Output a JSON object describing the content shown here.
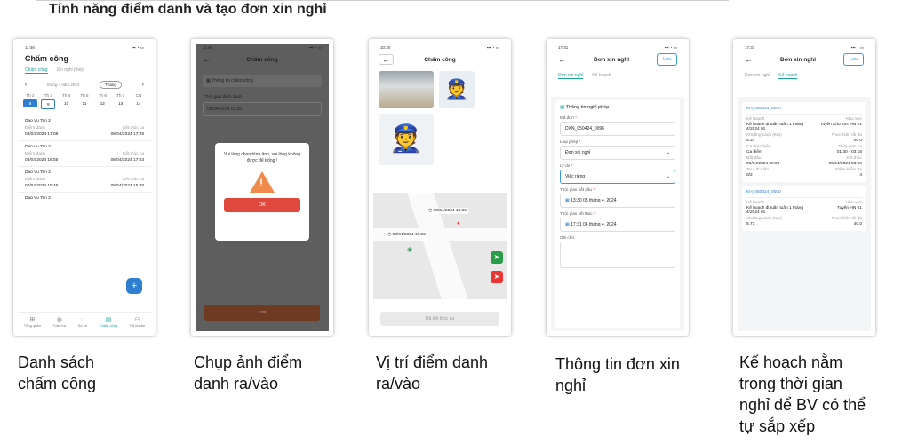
{
  "page_title": "Tính năng điểm danh và tạo đơn xin nghỉ",
  "captions": [
    [
      "Danh sách",
      "chấm công"
    ],
    [
      "Chụp ảnh điểm",
      "danh ra/vào"
    ],
    [
      "Vị trí điểm danh",
      "ra/vào"
    ],
    [
      "Thông tin đơn xin",
      "nghỉ"
    ],
    [
      "Kế hoạch nằm",
      "trong thời gian",
      "nghỉ để BV có thể",
      "tự sắp xếp"
    ]
  ],
  "s1": {
    "time": "11:46",
    "title": "Chấm công",
    "tab1": "Chấm công",
    "tab2": "Xin nghỉ phép",
    "week": "tháng 4 năm 2024",
    "mode": "Tháng",
    "days": [
      {
        "d": "Th 2",
        "n": "8"
      },
      {
        "d": "Th 3",
        "n": "9"
      },
      {
        "d": "Th 4",
        "n": "10"
      },
      {
        "d": "Th 5",
        "n": "11"
      },
      {
        "d": "Th 6",
        "n": "12"
      },
      {
        "d": "Th 7",
        "n": "13"
      },
      {
        "d": "CN",
        "n": "14"
      }
    ],
    "records": [
      {
        "name": "Dao Vu Tan 2",
        "l1": "Điểm danh",
        "l2": "Kết thúc ca",
        "v1": "08/04/2024 17:08",
        "v2": "08/04/2024 17:09"
      },
      {
        "name": "Dao Vu Tan 2",
        "l1": "Điểm danh",
        "l2": "Kết thúc ca",
        "v1": "08/04/2024 16:55",
        "v2": "08/04/2024 17:03"
      },
      {
        "name": "Dao Vu Tan 2",
        "l1": "Điểm danh",
        "l2": "Kết thúc ca",
        "v1": "08/04/2024 15:46",
        "v2": "08/04/2024 15:48"
      },
      {
        "name": "Dao Vu Tan 2",
        "l1": "",
        "l2": "",
        "v1": "",
        "v2": ""
      }
    ],
    "nav": [
      "Tổng quan",
      "Tuần tra",
      "Sự cố",
      "Chấm công",
      "Tài khoản"
    ]
  },
  "s2": {
    "time": "11:46",
    "title": "Chấm công",
    "section": "Thông tin chấm công",
    "time_label": "Thời gian điểm danh",
    "time_value": "08/04/2024 15:38",
    "dialog_text": "Vui lòng chọn hình ảnh, vui lòng không được để trống !",
    "ok": "OK",
    "bottom": "Lưu"
  },
  "s3": {
    "time": "10:20",
    "title": "Chấm công",
    "marker1": "08/04/2024 19:36",
    "marker2": "08/04/2024 19:36",
    "end_btn": "Đã kết thúc ca"
  },
  "s4": {
    "time": "17:31",
    "title": "Đơn xin nghỉ",
    "save": "Lưu",
    "tab1": "Đơn xin nghỉ",
    "tab2": "Kế hoạch",
    "section": "Thông tin nghỉ phép",
    "code_label": "Mã đơn",
    "code_value": "DXN_050424_0096",
    "type_label": "Loại phép",
    "type_value": "Đơn xin nghỉ",
    "reason_label": "Lý do",
    "reason_value": "Việc riêng",
    "start_label": "Thời gian bắt đầu",
    "start_value": "13:30 05 tháng 4, 2024",
    "end_label": "Thời gian kết thúc",
    "end_value": "17:31 06 tháng 4, 2024",
    "note_label": "Ghi chú"
  },
  "s5": {
    "time": "17:31",
    "title": "Đơn xin nghỉ",
    "save": "Lưu",
    "tab1": "Đơn xin nghỉ",
    "tab2": "Kế hoạch",
    "plans": [
      {
        "code": "KH_050424_0000",
        "k1": "Kế hoạch",
        "k2": "Khu vực",
        "plan": "Kế hoạch đi tuần tuần 1 tháng 4/2024 01",
        "area": "Tuyến Khu vực HN 01",
        "d1": "Khoảng cách (Km)",
        "d2": "Thực hiện tối đa",
        "dv1": "5.24",
        "dv2": "40.0",
        "c1": "Ca thực hiện",
        "c2": "Thời gian ca",
        "cv1": "Ca điểm",
        "cv2": "01:30 - 03:15",
        "b1": "Bắt đầu",
        "b2": "Kết thúc",
        "bv1": "06/04/2024 00:00",
        "bv2": "06/04/2024 23:59",
        "t1": "Tour đi tuần",
        "t2": "Điểm kiểm tra",
        "tv1": "0/2",
        "tv2": "4"
      },
      {
        "code": "KH_050424_0000",
        "k1": "Kế hoạch",
        "k2": "Khu vực",
        "plan": "Kế hoạch đi tuần tuần 1 tháng 4/2024 01",
        "area": "Tuyến HN 01",
        "d1": "Khoảng cách (Km)",
        "d2": "Thực hiện tối đa",
        "dv1": "5.71",
        "dv2": "40.0"
      }
    ]
  }
}
